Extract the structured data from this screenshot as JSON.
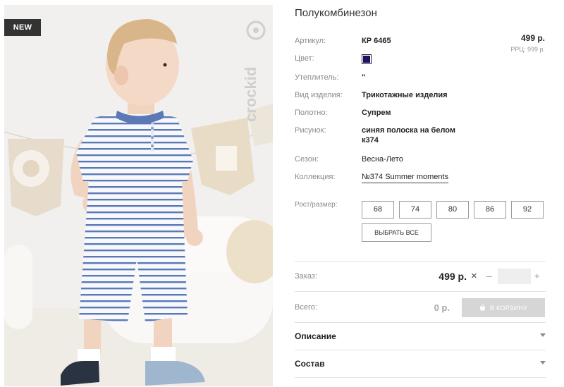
{
  "badge": "NEW",
  "brand_logo_text": "crockid",
  "product": {
    "title": "Полукомбинезон",
    "price": "499 р.",
    "rrp": "РРЦ: 999 р."
  },
  "attributes": [
    {
      "label": "Артикул:",
      "value": "КР 6465"
    },
    {
      "label": "Цвет:",
      "value": "",
      "swatch_color": "#1b1464"
    },
    {
      "label": "Утеплитель:",
      "value": "\""
    },
    {
      "label": "Вид изделия:",
      "value": "Трикотажные изделия"
    },
    {
      "label": "Полотно:",
      "value": "Супрем"
    },
    {
      "label": "Рисунок:",
      "value_line1": "синяя полоска на белом",
      "value_line2": "к374"
    },
    {
      "label": "Сезон:",
      "value": "Весна-Лето"
    },
    {
      "label": "Коллекция:",
      "value": "№374 Summer moments"
    }
  ],
  "sizes": {
    "label": "Рост/размер:",
    "options": [
      "68",
      "74",
      "80",
      "86",
      "92"
    ],
    "select_all": "ВЫБРАТЬ ВСЕ"
  },
  "order": {
    "label": "Заказ:",
    "price": "499 р.",
    "times": "×",
    "minus": "–",
    "plus": "+",
    "quantity": ""
  },
  "total": {
    "label": "Всего:",
    "value": "0 р.",
    "cart_button": "В КОРЗИНУ"
  },
  "accordion": [
    {
      "label": "Описание"
    },
    {
      "label": "Состав"
    }
  ],
  "colors": {
    "accent_swatch": "#1b1464",
    "stripe": "#5b79b6",
    "badge_bg": "#333333",
    "cart_disabled": "#d6d6d6"
  }
}
